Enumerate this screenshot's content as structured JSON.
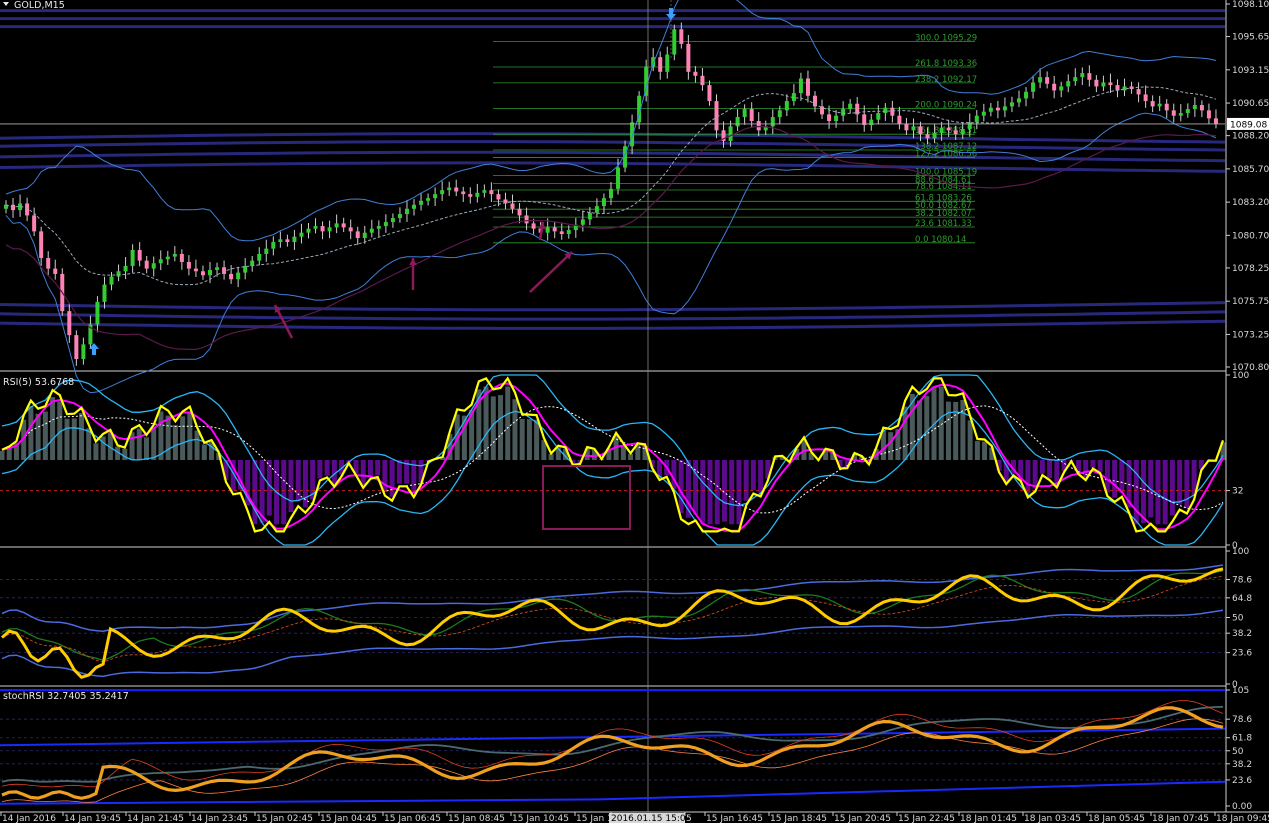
{
  "chart_data": [
    {
      "type": "candlestick",
      "title": "GOLD,M15",
      "ylim": [
        1070.8,
        1098.1
      ],
      "y_ticks": [
        "1098.10",
        "1095.65",
        "1093.15",
        "1090.65",
        "1088.20",
        "1085.70",
        "1083.20",
        "1080.70",
        "1078.25",
        "1075.75",
        "1073.25",
        "1070.80"
      ],
      "current_price": "1089.08",
      "fibonacci_levels": [
        {
          "label": "300.0  1095.29",
          "value": 1095.29
        },
        {
          "label": "261.8  1093.36",
          "value": 1093.36
        },
        {
          "label": "238.2  1092.17",
          "value": 1092.17
        },
        {
          "label": "200.0  1090.24",
          "value": 1090.24
        },
        {
          "label": "161.8  1088.31",
          "value": 1088.31
        },
        {
          "label": "138.2  1087.12",
          "value": 1087.12
        },
        {
          "label": "127.2  1086.56",
          "value": 1086.56
        },
        {
          "label": "100.0  1085.19",
          "value": 1085.19
        },
        {
          "label": "88.6  1084.61",
          "value": 1084.61
        },
        {
          "label": "78.6  1084.11",
          "value": 1084.11
        },
        {
          "label": "61.8  1083.26",
          "value": 1083.26
        },
        {
          "label": "50.0  1082.67",
          "value": 1082.67
        },
        {
          "label": "38.2  1082.07",
          "value": 1082.07
        },
        {
          "label": "23.6  1081.33",
          "value": 1081.33
        },
        {
          "label": "0.0  1080.14",
          "value": 1080.14
        }
      ],
      "close_series": [
        1083.0,
        1082.6,
        1083.1,
        1082.2,
        1081.0,
        1079.0,
        1078.2,
        1077.8,
        1075.0,
        1073.2,
        1071.4,
        1072.5,
        1074.0,
        1075.7,
        1077.0,
        1077.6,
        1078.0,
        1078.4,
        1079.6,
        1078.8,
        1078.2,
        1078.6,
        1078.9,
        1079.1,
        1079.3,
        1078.7,
        1078.2,
        1078.0,
        1077.7,
        1078.1,
        1078.3,
        1077.8,
        1077.4,
        1077.9,
        1078.4,
        1078.8,
        1079.3,
        1079.7,
        1080.2,
        1080.4,
        1080.2,
        1080.6,
        1080.9,
        1081.2,
        1081.4,
        1081.0,
        1081.3,
        1081.6,
        1081.3,
        1081.0,
        1080.5,
        1080.9,
        1081.2,
        1081.4,
        1081.7,
        1082.0,
        1082.3,
        1082.7,
        1083.0,
        1083.3,
        1083.5,
        1083.8,
        1084.1,
        1084.3,
        1084.0,
        1083.8,
        1083.6,
        1083.9,
        1084.1,
        1083.8,
        1083.4,
        1083.1,
        1082.7,
        1082.2,
        1081.6,
        1081.2,
        1080.9,
        1081.3,
        1081.0,
        1080.8,
        1081.1,
        1081.5,
        1081.9,
        1082.4,
        1082.9,
        1083.5,
        1084.2,
        1085.8,
        1087.4,
        1089.2,
        1091.2,
        1093.4,
        1094.1,
        1093.0,
        1094.3,
        1096.2,
        1095.1,
        1093.0,
        1092.7,
        1092.0,
        1090.8,
        1088.6,
        1087.8,
        1088.9,
        1089.6,
        1090.2,
        1089.3,
        1088.6,
        1088.9,
        1089.6,
        1090.1,
        1090.8,
        1091.4,
        1092.5,
        1091.2,
        1090.4,
        1089.8,
        1089.3,
        1089.7,
        1090.2,
        1090.6,
        1089.8,
        1089.0,
        1089.4,
        1089.9,
        1090.3,
        1089.7,
        1089.1,
        1088.6,
        1088.9,
        1088.3,
        1088.0,
        1088.4,
        1088.8,
        1088.6,
        1088.3,
        1088.7,
        1089.2,
        1089.7,
        1090.0,
        1090.3,
        1090.1,
        1090.4,
        1090.7,
        1091.0,
        1091.5,
        1092.2,
        1092.6,
        1092.1,
        1091.6,
        1091.9,
        1092.3,
        1092.6,
        1092.9,
        1092.4,
        1091.9,
        1092.2,
        1092.0,
        1091.6,
        1091.9,
        1091.7,
        1091.3,
        1090.8,
        1090.4,
        1090.6,
        1090.1,
        1089.7,
        1089.9,
        1090.2,
        1090.5,
        1090.1,
        1089.5,
        1089.1
      ],
      "arrows": [
        "up",
        "up",
        "up",
        "up",
        "down"
      ]
    },
    {
      "type": "line",
      "title": "RSI(5) 53.6768",
      "ylim": [
        0,
        100
      ],
      "y_ticks": [
        "100",
        "32",
        "0"
      ],
      "level": 32
    },
    {
      "type": "line",
      "title": "",
      "ylim": [
        0,
        100
      ],
      "y_ticks": [
        "100",
        "78.6",
        "64.8",
        "50",
        "38.2",
        "23.6",
        "0"
      ]
    },
    {
      "type": "line",
      "title": "stochRSI 32.7405 35.2417",
      "ylim": [
        0,
        105
      ],
      "y_ticks": [
        "105",
        "78.6",
        "61.8",
        "50",
        "38.2",
        "23.6",
        "0.00"
      ]
    }
  ],
  "x_axis": {
    "labels": [
      "14 Jan 2016",
      "14 Jan 19:45",
      "14 Jan 21:45",
      "14 Jan 23:45",
      "15 Jan 02:45",
      "15 Jan 04:45",
      "15 Jan 06:45",
      "15 Jan 08:45",
      "15 Jan 10:45",
      "15 Jan 1",
      "2016.01.15 15:00",
      "5",
      "15 Jan 16:45",
      "15 Jan 18:45",
      "15 Jan 20:45",
      "15 Jan 22:45",
      "18 Jan 01:45",
      "18 Jan 03:45",
      "18 Jan 05:45",
      "18 Jan 07:45",
      "18 Jan 09:45"
    ]
  },
  "colors": {
    "background": "#000000",
    "bull": "#32cd32",
    "bear": "#ff82b4",
    "fib": "#2e9a2e",
    "rsi": "#ffff00",
    "ma": "#ff00ff",
    "band": "#00bfff",
    "stoch": "#f0a020"
  }
}
